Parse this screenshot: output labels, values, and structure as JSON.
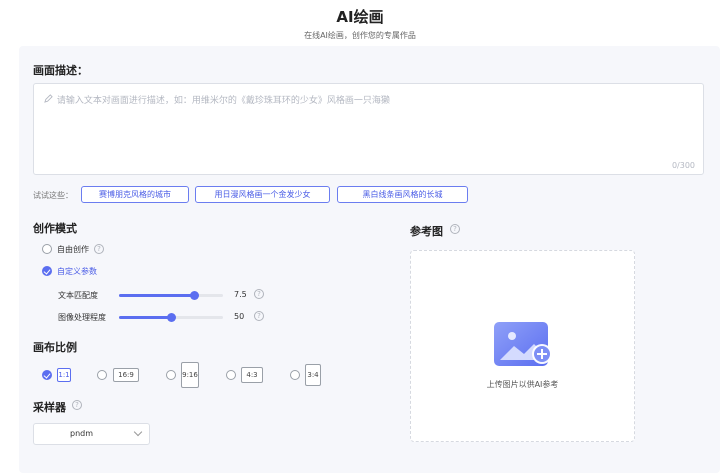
{
  "header": {
    "title": "AI绘画",
    "subtitle": "在线AI绘画，创作您的专属作品"
  },
  "prompt": {
    "label": "画面描述：",
    "placeholder": "请输入文本对画面进行描述，如：用维米尔的《戴珍珠耳环的少女》风格画一只海獭",
    "counter": "0/300"
  },
  "suggestions": {
    "label": "试试这些：",
    "items": [
      "赛博朋克风格的城市",
      "用日漫风格画一个金发少女",
      "黑白线条画风格的长城"
    ]
  },
  "mode": {
    "label": "创作模式",
    "options": [
      {
        "label": "自由创作",
        "selected": false
      },
      {
        "label": "自定义参数",
        "selected": true
      }
    ],
    "sliders": [
      {
        "label": "文本匹配度",
        "value": "7.5",
        "fraction": 0.72
      },
      {
        "label": "图像处理程度",
        "value": "50",
        "fraction": 0.5
      }
    ]
  },
  "ratio": {
    "label": "画布比例",
    "options": [
      {
        "label": "1:1",
        "selected": true
      },
      {
        "label": "16:9",
        "selected": false
      },
      {
        "label": "9:16",
        "selected": false
      },
      {
        "label": "4:3",
        "selected": false
      },
      {
        "label": "3:4",
        "selected": false
      }
    ]
  },
  "sampler": {
    "label": "采样器",
    "value": "pndm"
  },
  "reference": {
    "label": "参考图",
    "upload_text": "上传图片以供AI参考"
  },
  "colors": {
    "accent": "#5b6ef0"
  }
}
